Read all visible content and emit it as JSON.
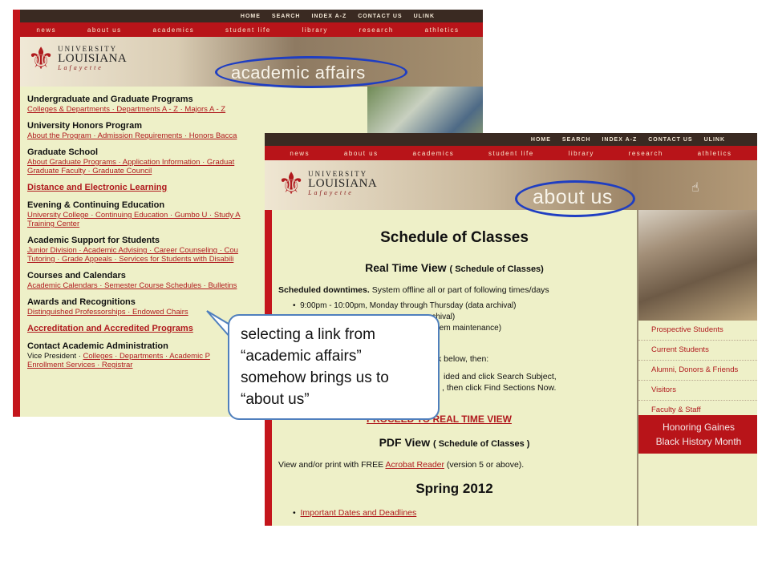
{
  "window1": {
    "top_nav": [
      "HOME",
      "SEARCH",
      "INDEX A-Z",
      "CONTACT US",
      "ULINK"
    ],
    "main_nav": [
      "news",
      "about us",
      "academics",
      "student life",
      "library",
      "research",
      "athletics"
    ],
    "logo": {
      "line1": "UNIVERSITY",
      "line2": "LOUISIANA",
      "line3": "Lafayette"
    },
    "section_title": "academic affairs",
    "groups": [
      {
        "heading": "Undergraduate and Graduate Programs",
        "links": "Colleges & Departments · Departments A - Z · Majors A - Z"
      },
      {
        "heading": "University Honors Program",
        "links": "About the Program · Admission Requirements · Honors Bacca"
      },
      {
        "heading": "Graduate School",
        "links": "About Graduate Programs · Application Information · Graduat",
        "links2": "Graduate Faculty · Graduate Council"
      },
      {
        "heading": "Distance and Electronic Learning"
      },
      {
        "heading": "Evening & Continuing Education",
        "links": "University College · Continuing Education · Gumbo U · Study A",
        "links2": "Training Center"
      },
      {
        "heading": "Academic Support for Students",
        "links": "Junior Division · Academic Advising · Career Counseling · Cou",
        "links2": "Tutoring · Grade Appeals · Services for Students with Disabili"
      },
      {
        "heading": "Courses and Calendars",
        "links": "Academic Calendars · Semester Course Schedules · Bulletins"
      },
      {
        "heading": "Awards and Recognitions",
        "links": "Distinguished Professorships · Endowed Chairs"
      },
      {
        "heading": "Accreditation and Accredited Programs"
      },
      {
        "heading": "Contact Academic Administration",
        "links_prefix": "Vice President · ",
        "links": "Colleges · Departments · Academic P",
        "links2": "Enrollment Services · Registrar"
      }
    ]
  },
  "window2": {
    "top_nav": [
      "HOME",
      "SEARCH",
      "INDEX A-Z",
      "CONTACT US",
      "ULINK"
    ],
    "main_nav": [
      "news",
      "about us",
      "academics",
      "student life",
      "library",
      "research",
      "athletics"
    ],
    "logo": {
      "line1": "UNIVERSITY",
      "line2": "LOUISIANA",
      "line3": "Lafayette"
    },
    "section_title": "about us",
    "page_title": "Schedule of Classes",
    "realtime_heading": "Real Time View",
    "realtime_sub": "( Schedule of Classes)",
    "downtime_label": "Scheduled downtimes.",
    "downtime_text": " System offline all or part of following times/days",
    "bullet1": "9:00pm - 10:00pm, Monday through Thursday (data archival)",
    "bullet2_tail": "rchival)",
    "bullet3_tail": "ystem maintenance)",
    "line_below": "k below, then:",
    "line_provided": "ided and click Search Subject,",
    "line_find": ", then click Find Sections Now.",
    "proceed_link": "PROCEED TO REAL TIME VIEW",
    "pdf_heading": "PDF View",
    "pdf_sub": "( Schedule of Classes )",
    "view_prefix": "View and/or print with FREE ",
    "acrobat_link": "Acrobat Reader",
    "view_suffix": " (version 5 or above).",
    "term_heading": "Spring 2012",
    "term_link": "Important Dates and Deadlines",
    "sidebar_links": [
      "Prospective Students",
      "Current Students",
      "Alumni, Donors & Friends",
      "Visitors",
      "Faculty & Staff"
    ],
    "banner_line1": "Honoring Gaines",
    "banner_line2": "Black History Month"
  },
  "callout": {
    "line1": "selecting a link from",
    "line2": "“academic affairs”",
    "line3": "somehow brings us to",
    "line4": "“about us”"
  },
  "colors": {
    "brand_red": "#c4161c",
    "highlight_blue": "#1f3ec2",
    "callout_border": "#4f7fbd",
    "page_bg": "#eef0c8"
  }
}
